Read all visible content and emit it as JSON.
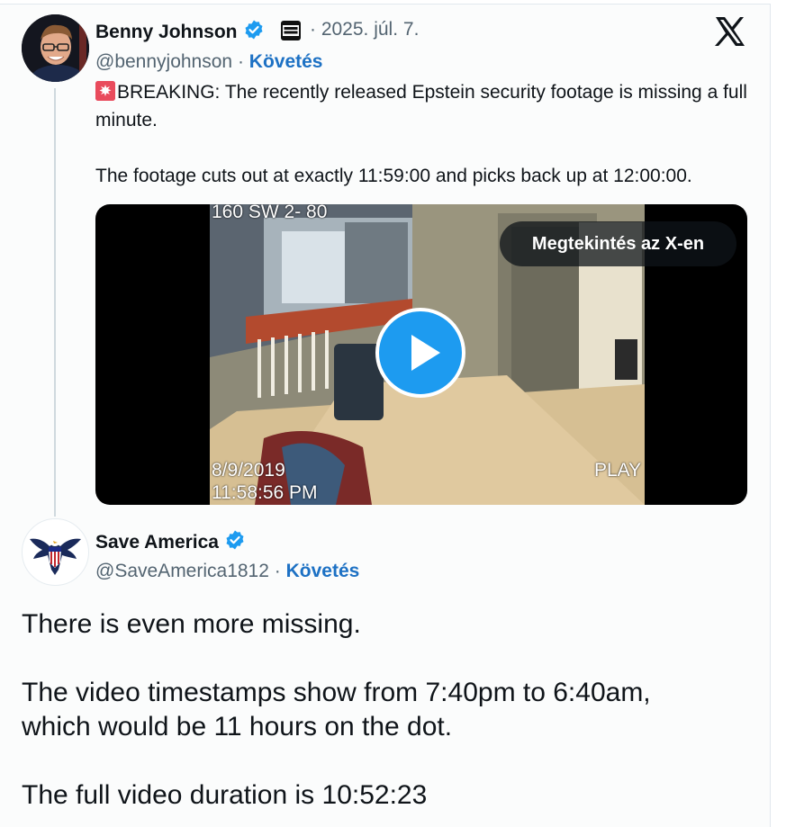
{
  "original_tweet": {
    "author_name": "Benny Johnson",
    "date": "· 2025. júl. 7.",
    "handle": "@bennyjohnson",
    "separator": " · ",
    "follow_label": "Követés",
    "text_line1": "BREAKING: The recently released Epstein security footage is missing a full minute.",
    "text_line2": "The footage cuts out at exactly 11:59:00 and picks back up at 12:00:00.",
    "icons": {
      "alert": "rotating-light-icon",
      "verified": "verified-badge-icon",
      "platform": "x-logo-icon"
    },
    "video": {
      "camera_label": "160 SW 2- 80",
      "date_stamp": "8/9/2019",
      "time_stamp": "11:58:56 PM",
      "play_label": "PLAY",
      "view_button": "Megtekintés az X-en"
    }
  },
  "reply": {
    "author_name": "Save America",
    "handle": "@SaveAmerica1812",
    "separator": " · ",
    "follow_label": "Követés",
    "text": "There is even more missing.\n\nThe video timestamps show from 7:40pm to 6:40am,\nwhich would be 11 hours on the dot.\n\nThe full video duration is 10:52:23"
  },
  "colors": {
    "accent": "#1d9bf0",
    "link": "#1d71c4",
    "muted": "#536471",
    "text": "#0f1419"
  }
}
